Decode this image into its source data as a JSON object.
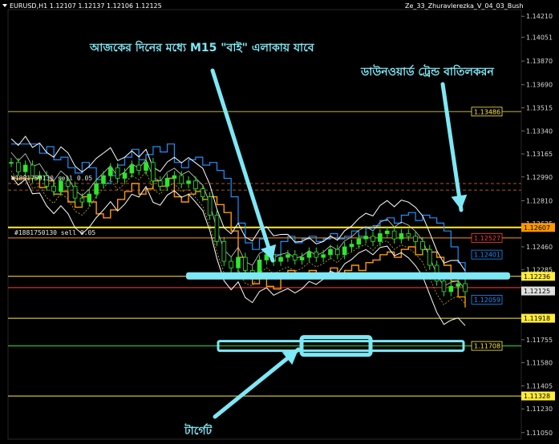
{
  "header": {
    "symbol_label": "EURUSD,H1  1.12107 1.12137 1.12106 1.12125",
    "indicator_label": "Ze_33_Zhuravlerezka_V_04_03_Bush"
  },
  "annotations": {
    "top": "আজকের দিনের মধ্যে M15 \"বাই\" এলাকায় যাবে",
    "right": "ডাউনওয়ার্ড ট্রেন্ড বাতিলকরন",
    "bottom": "টার্গেট"
  },
  "orders": {
    "upper": "#1881750130 sell 0.05",
    "lower": "#1881750130 sell 0.05"
  },
  "colors": {
    "background": "#000000",
    "candle": "#2ee62e",
    "bands": "#ffffff",
    "channel": "#ff9800",
    "blue_line": "#1e90ff",
    "level": "#ffeb3b",
    "annotation": "#7ee8f5",
    "red_label": "#ff3b3b"
  },
  "chart_data": {
    "type": "line",
    "y_axis": {
      "ticks": [
        "1.14210",
        "1.14051",
        "1.13870",
        "1.13690",
        "1.13515",
        "1.13340",
        "1.13165",
        "1.12990",
        "1.12810",
        "1.12635",
        "1.12460",
        "1.12285",
        "1.12110",
        "1.11930",
        "1.11755",
        "1.11580",
        "1.11405",
        "1.11230",
        "1.11050"
      ],
      "ylim": [
        1.11,
        1.1426
      ]
    },
    "price_labels": [
      {
        "value": "1.13486",
        "style": "boxed",
        "color": "#ffeb3b"
      },
      {
        "value": "1.12607",
        "style": "filled",
        "color": "#ff9800"
      },
      {
        "value": "1.12527",
        "style": "boxed",
        "color": "#ff3b3b"
      },
      {
        "value": "1.12401",
        "style": "boxed",
        "color": "#1e90ff"
      },
      {
        "value": "1.12236",
        "style": "filled",
        "color": "#ffeb3b"
      },
      {
        "value": "1.12125",
        "style": "filled",
        "color": "#e0e0e0"
      },
      {
        "value": "1.12059",
        "style": "boxed",
        "color": "#1e90ff"
      },
      {
        "value": "1.11918",
        "style": "filled",
        "color": "#ffeb3b"
      },
      {
        "value": "1.11708",
        "style": "boxed",
        "color": "#ffeb3b"
      },
      {
        "value": "1.11328",
        "style": "filled",
        "color": "#ffeb3b"
      }
    ],
    "levels": [
      {
        "price": 1.13486,
        "color": "#c8b400",
        "width": 1
      },
      {
        "price": 1.12607,
        "color": "#ffeb3b",
        "width": 2
      },
      {
        "price": 1.12527,
        "color": "#ff9800",
        "width": 1
      },
      {
        "price": 1.12236,
        "color": "#ffeb3b",
        "width": 1
      },
      {
        "price": 1.1215,
        "color": "#ff3b3b",
        "width": 1
      },
      {
        "price": 1.11918,
        "color": "#ffeb3b",
        "width": 1
      },
      {
        "price": 1.11708,
        "color": "#2ee62e",
        "width": 1
      },
      {
        "price": 1.11328,
        "color": "#ffeb3b",
        "width": 1
      }
    ],
    "dashed_levels": [
      {
        "price": 1.1294,
        "color": "#8b4513"
      },
      {
        "price": 1.1289,
        "color": "#8b4513"
      }
    ],
    "close_series": [
      1.131,
      1.1303,
      1.1308,
      1.1298,
      1.13,
      1.1292,
      1.1288,
      1.1296,
      1.1292,
      1.1283,
      1.128,
      1.1286,
      1.1294,
      1.13,
      1.1306,
      1.1298,
      1.1302,
      1.1308,
      1.1304,
      1.131,
      1.1296,
      1.1292,
      1.1298,
      1.13,
      1.1294,
      1.1296,
      1.129,
      1.1284,
      1.127,
      1.125,
      1.1235,
      1.123,
      1.1238,
      1.1228,
      1.1226,
      1.1236,
      1.124,
      1.1235,
      1.1238,
      1.124,
      1.1236,
      1.1238,
      1.1242,
      1.1238,
      1.124,
      1.1244,
      1.124,
      1.1246,
      1.1248,
      1.1252,
      1.1254,
      1.125,
      1.1256,
      1.1258,
      1.1252,
      1.1256,
      1.1254,
      1.125,
      1.1244,
      1.1232,
      1.122,
      1.1212,
      1.1216,
      1.1218,
      1.1212
    ]
  }
}
